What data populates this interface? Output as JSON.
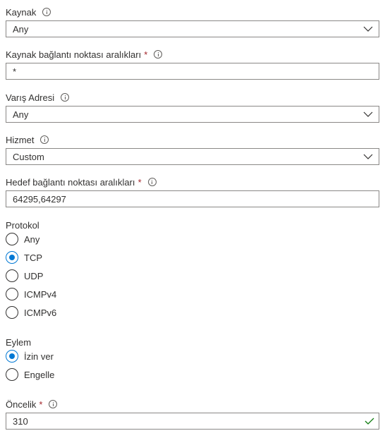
{
  "fields": {
    "source": {
      "label": "Kaynak",
      "value": "Any"
    },
    "source_port_ranges": {
      "label": "Kaynak bağlantı noktası aralıkları",
      "required_mark": "*",
      "value": "*"
    },
    "destination": {
      "label": "Varış Adresi",
      "value": "Any"
    },
    "service": {
      "label": "Hizmet",
      "value": "Custom"
    },
    "destination_port_ranges": {
      "label": "Hedef bağlantı noktası aralıkları",
      "required_mark": "*",
      "value": "64295,64297"
    },
    "protocol": {
      "label": "Protokol",
      "options": [
        "Any",
        "TCP",
        "UDP",
        "ICMPv4",
        "ICMPv6"
      ],
      "selected": "TCP"
    },
    "action": {
      "label": "Eylem",
      "options": [
        "İzin ver",
        "Engelle"
      ],
      "selected": "İzin ver"
    },
    "priority": {
      "label": "Öncelik",
      "required_mark": "*",
      "value": "310",
      "valid": true
    }
  },
  "colors": {
    "accent": "#0078d4",
    "required": "#a4262c",
    "valid": "#107c10",
    "border": "#8a8886",
    "text": "#323130"
  },
  "icons": {
    "info": "info-icon",
    "dropdown": "chevron-down-icon",
    "valid": "checkmark-icon"
  }
}
